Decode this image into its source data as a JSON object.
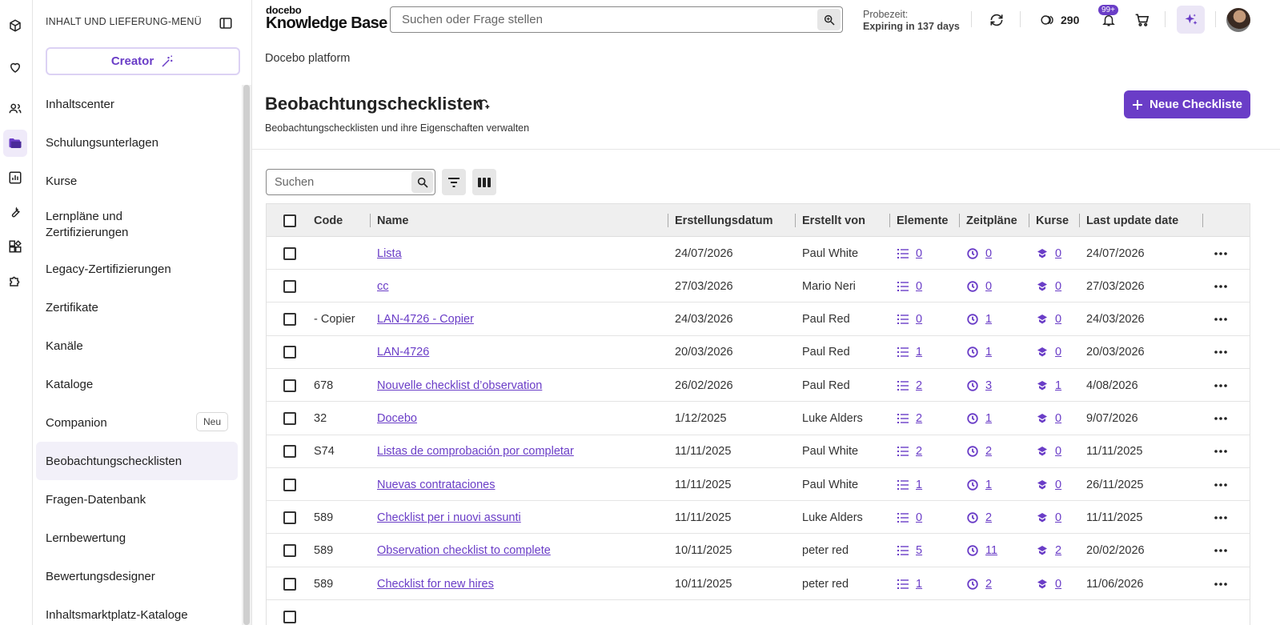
{
  "sidebar": {
    "title": "INHALT UND LIEFERUNG-MENÜ",
    "creator_label": "Creator",
    "items": [
      {
        "label": "Inhaltscenter"
      },
      {
        "label": "Schulungsunterlagen"
      },
      {
        "label": "Kurse"
      },
      {
        "label": "Lernpläne und Zertifizierungen"
      },
      {
        "label": "Legacy-Zertifizierungen"
      },
      {
        "label": "Zertifikate"
      },
      {
        "label": "Kanäle"
      },
      {
        "label": "Kataloge"
      },
      {
        "label": "Companion",
        "badge": "Neu"
      },
      {
        "label": "Beobachtungschecklisten"
      },
      {
        "label": "Fragen-Datenbank"
      },
      {
        "label": "Lernbewertung"
      },
      {
        "label": "Bewertungsdesigner"
      },
      {
        "label": "Inhaltsmarktplatz-Kataloge"
      }
    ]
  },
  "topbar": {
    "logo_small": "docebo",
    "logo_big": "Knowledge Base",
    "search_placeholder": "Suchen oder Frage stellen",
    "trial_label": "Probezeit:",
    "trial_value": "Expiring in 137 days",
    "credits": "290",
    "notifications_badge": "99+"
  },
  "page": {
    "breadcrumb": "Docebo platform",
    "title": "Beobachtungschecklisten",
    "subtitle": "Beobachtungschecklisten und ihre Eigenschaften verwalten",
    "new_button": "Neue Checkliste",
    "search_placeholder": "Suchen"
  },
  "table": {
    "headers": {
      "code": "Code",
      "name": "Name",
      "created": "Erstellungsdatum",
      "author": "Erstellt von",
      "elements": "Elemente",
      "schedules": "Zeitpläne",
      "courses": "Kurse",
      "updated": "Last update date"
    },
    "rows": [
      {
        "code": "",
        "name": "Lista",
        "created": "24/07/2026",
        "author": "Paul White",
        "elements": "0",
        "schedules": "0",
        "courses": "0",
        "updated": "24/07/2026"
      },
      {
        "code": "",
        "name": "cc",
        "created": "27/03/2026",
        "author": "Mario Neri",
        "elements": "0",
        "schedules": "0",
        "courses": "0",
        "updated": "27/03/2026"
      },
      {
        "code": "- Copier",
        "name": "LAN-4726 - Copier",
        "created": "24/03/2026",
        "author": "Paul Red",
        "elements": "0",
        "schedules": "1",
        "courses": "0",
        "updated": "24/03/2026"
      },
      {
        "code": "",
        "name": "LAN-4726",
        "created": "20/03/2026",
        "author": "Paul Red",
        "elements": "1",
        "schedules": "1",
        "courses": "0",
        "updated": "20/03/2026"
      },
      {
        "code": "678",
        "name": "Nouvelle checklist d’observation",
        "created": "26/02/2026",
        "author": "Paul Red",
        "elements": "2",
        "schedules": "3",
        "courses": "1",
        "updated": "4/08/2026"
      },
      {
        "code": "32",
        "name": "Docebo",
        "created": "1/12/2025",
        "author": "Luke Alders",
        "elements": "2",
        "schedules": "1",
        "courses": "0",
        "updated": "9/07/2026"
      },
      {
        "code": "S74",
        "name": "Listas de comprobación por completar",
        "created": "11/11/2025",
        "author": "Paul White",
        "elements": "2",
        "schedules": "2",
        "courses": "0",
        "updated": "11/11/2025"
      },
      {
        "code": "",
        "name": "Nuevas contrataciones",
        "created": "11/11/2025",
        "author": "Paul White",
        "elements": "1",
        "schedules": "1",
        "courses": "0",
        "updated": "26/11/2025"
      },
      {
        "code": "589",
        "name": "Checklist per i nuovi assunti",
        "created": "11/11/2025",
        "author": "Luke Alders",
        "elements": "0",
        "schedules": "2",
        "courses": "0",
        "updated": "11/11/2025"
      },
      {
        "code": "589",
        "name": "Observation checklist to complete",
        "created": "10/11/2025",
        "author": "peter red",
        "elements": "5",
        "schedules": "11",
        "courses": "2",
        "updated": "20/02/2026"
      },
      {
        "code": "589",
        "name": "Checklist for new hires",
        "created": "10/11/2025",
        "author": "peter red",
        "elements": "1",
        "schedules": "2",
        "courses": "0",
        "updated": "11/06/2026"
      }
    ]
  },
  "colors": {
    "accent": "#6a3dc7",
    "accent_light": "#ebe6f6"
  }
}
